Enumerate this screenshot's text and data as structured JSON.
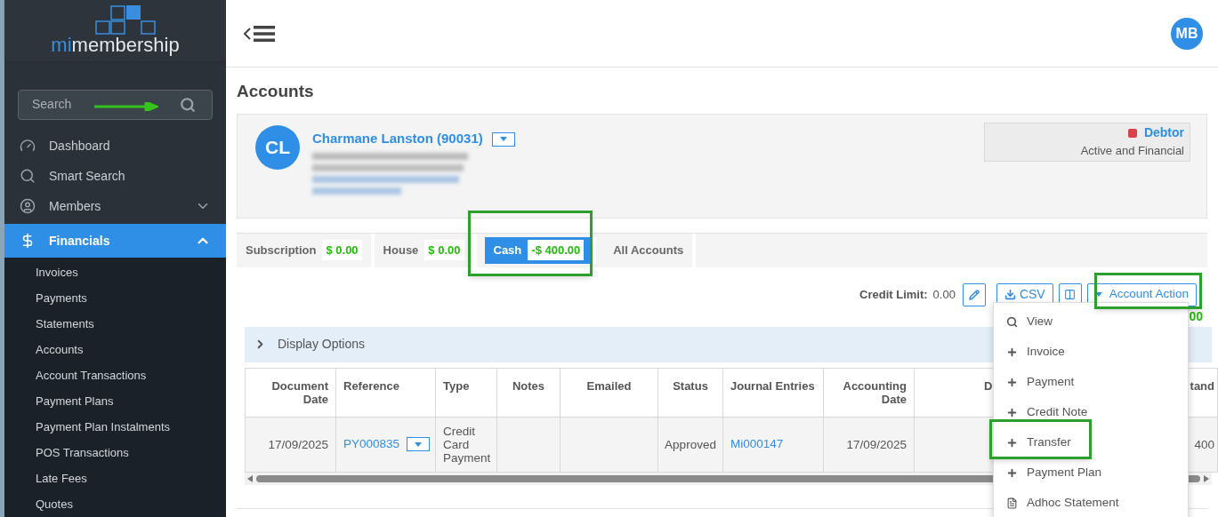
{
  "logo": {
    "prefix": "mi",
    "name": "membership"
  },
  "search": {
    "placeholder": "Search"
  },
  "sidebar": {
    "items": [
      {
        "label": "Dashboard",
        "kind": "link",
        "selected": false
      },
      {
        "label": "Smart Search",
        "kind": "link",
        "selected": false
      },
      {
        "label": "Members",
        "kind": "group",
        "selected": false,
        "expanded": false
      },
      {
        "label": "Financials",
        "kind": "group",
        "selected": true,
        "expanded": true,
        "children": [
          {
            "label": "Invoices"
          },
          {
            "label": "Payments"
          },
          {
            "label": "Statements"
          },
          {
            "label": "Accounts"
          },
          {
            "label": "Account Transactions"
          },
          {
            "label": "Payment Plans"
          },
          {
            "label": "Payment Plan Instalments"
          },
          {
            "label": "POS Transactions"
          },
          {
            "label": "Late Fees"
          },
          {
            "label": "Quotes"
          }
        ]
      }
    ]
  },
  "user": {
    "initials": "MB"
  },
  "page_title": "Accounts",
  "member": {
    "initials": "CL",
    "name": "Charmane Lanston (90031)",
    "status": "Debtor",
    "standing": "Active and Financial"
  },
  "tabs": [
    {
      "label": "Subscription",
      "amount": "$ 0.00",
      "selected": false
    },
    {
      "label": "House",
      "amount": "$ 0.00",
      "selected": false
    },
    {
      "label": "Cash",
      "amount": "-$ 400.00",
      "selected": true
    },
    {
      "label": "All Accounts",
      "selected": false
    }
  ],
  "toolbar": {
    "credit_label": "Credit Limit:",
    "credit_value": "0.00",
    "csv": "CSV",
    "action": "Account Action",
    "balance": "00"
  },
  "display_options": {
    "label": "Display Options",
    "expanded": false
  },
  "table": {
    "columns": [
      "Document Date",
      "Reference",
      "Type",
      "Notes",
      "Emailed",
      "Status",
      "Journal Entries",
      "Accounting Date",
      "D",
      "tand"
    ],
    "rows": [
      {
        "cells": [
          "17/09/2025",
          "PY000835",
          "Credit Card Payment",
          "",
          "",
          "Approved",
          "Mi000147",
          "17/09/2025",
          "",
          "400"
        ]
      }
    ]
  },
  "menu": {
    "items": [
      {
        "label": "View",
        "kind": "search"
      },
      {
        "label": "Invoice",
        "kind": "add"
      },
      {
        "label": "Payment",
        "kind": "add"
      },
      {
        "label": "Credit Note",
        "kind": "add"
      },
      {
        "label": "Transfer",
        "kind": "add"
      },
      {
        "label": "Payment Plan",
        "kind": "add"
      },
      {
        "label": "Adhoc Statement",
        "kind": "document"
      }
    ]
  }
}
